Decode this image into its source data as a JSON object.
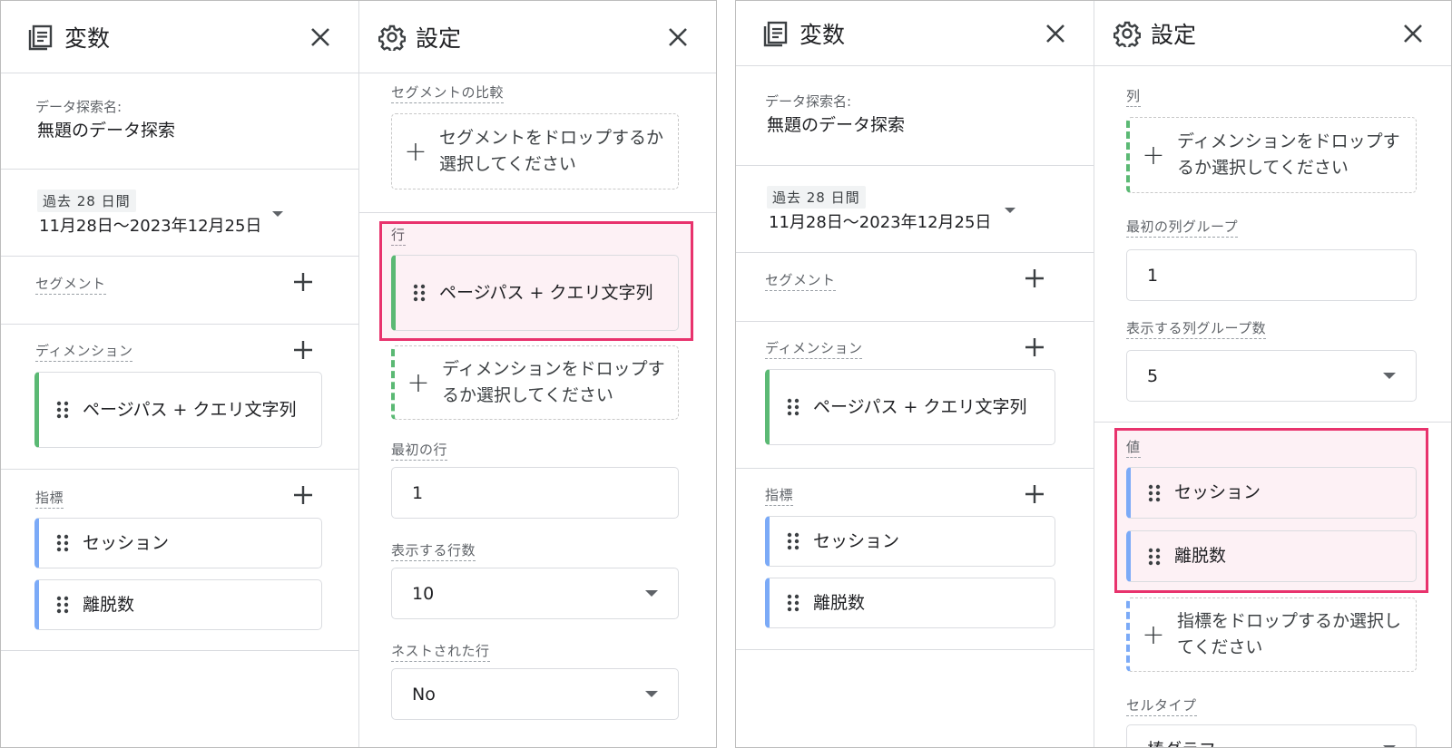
{
  "vars": {
    "title": "変数",
    "exploration_name_label": "データ探索名:",
    "exploration_name": "無題のデータ探索",
    "date_badge": "過去 28 日間",
    "date_range": "11月28日〜2023年12月25日",
    "segments_label": "セグメント",
    "dimensions_label": "ディメンション",
    "dimension_chip": "ページパス + クエリ文字列",
    "metrics_label": "指標",
    "metric_chips": [
      "セッション",
      "離脱数"
    ]
  },
  "settings_left": {
    "title": "設定",
    "segment_compare_label": "セグメントの比較",
    "segment_drop": "セグメントをドロップするか選択してください",
    "rows_label": "行",
    "row_chip": "ページパス + クエリ文字列",
    "dimension_drop": "ディメンションをドロップするか選択してください",
    "first_row_label": "最初の行",
    "first_row_value": "1",
    "rows_shown_label": "表示する行数",
    "rows_shown_value": "10",
    "nested_rows_label": "ネストされた行",
    "nested_rows_value": "No"
  },
  "settings_right": {
    "title": "設定",
    "columns_label": "列",
    "dimension_drop": "ディメンションをドロップするか選択してください",
    "first_group_label": "最初の列グループ",
    "first_group_value": "1",
    "groups_shown_label": "表示する列グループ数",
    "groups_shown_value": "5",
    "values_label": "値",
    "value_chips": [
      "セッション",
      "離脱数"
    ],
    "metric_drop": "指標をドロップするか選択してください",
    "cell_type_label": "セルタイプ",
    "cell_type_value": "棒グラフ"
  },
  "colors": {
    "highlight": "#e8336d",
    "dimension_accent": "#5bb974",
    "metric_accent": "#7baaf7"
  },
  "icons": [
    "variables-icon",
    "gear-icon",
    "close-icon",
    "plus-icon",
    "drag-handle-icon",
    "dropdown-arrow-icon"
  ]
}
